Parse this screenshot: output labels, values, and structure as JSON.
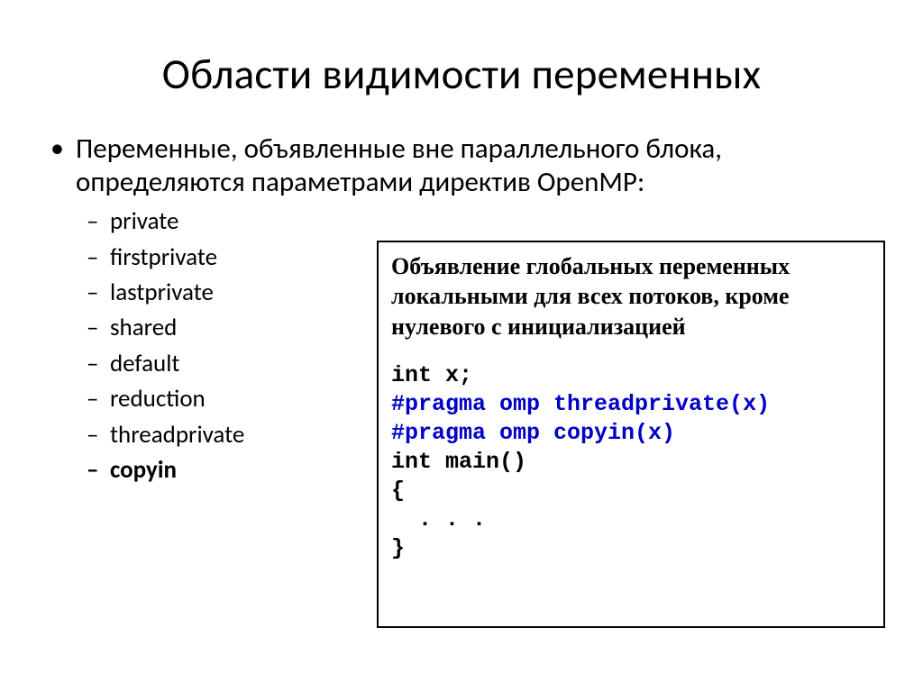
{
  "title": "Области видимости переменных",
  "bullet_intro": "Переменные, объявленные вне параллельного блока, определяются параметрами директив OpenMP:",
  "items": {
    "i0": "private",
    "i1": "firstprivate",
    "i2": "lastprivate",
    "i3": "shared",
    "i4": "default",
    "i5": "reduction",
    "i6": "threadprivate",
    "i7": "copyin"
  },
  "box": {
    "desc": "Объявление глобальных переменных локальными для всех потоков, кроме нулевого с инициализацией",
    "code": {
      "l0": "int x;",
      "l1": "#pragma omp threadprivate(x)",
      "l2": "#pragma omp copyin(x)",
      "l3": "int main()",
      "l4": "{",
      "l5": "  . . .",
      "l6": "}"
    }
  }
}
